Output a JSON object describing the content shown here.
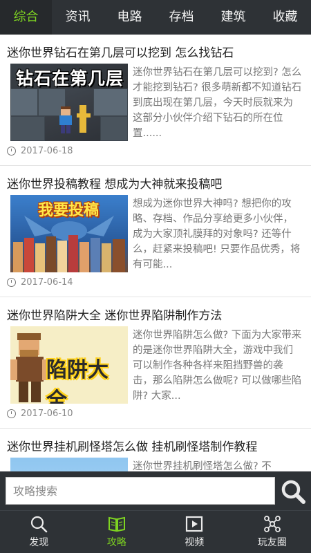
{
  "tabs": [
    {
      "label": "综合",
      "active": true
    },
    {
      "label": "资讯",
      "active": false
    },
    {
      "label": "电路",
      "active": false
    },
    {
      "label": "存档",
      "active": false
    },
    {
      "label": "建筑",
      "active": false
    },
    {
      "label": "收藏",
      "active": false
    }
  ],
  "articles": [
    {
      "title": "迷你世界钻石在第几层可以挖到 怎么找钻石",
      "thumb_text": "钻石在第几层",
      "summary": "迷你世界钻石在第几层可以挖到? 怎么才能挖到钻石? 很多萌新都不知道钻石到底出现在第几层，今天时辰就来为这部分小伙伴介绍下钻石的所在位置......",
      "date": "2017-06-18"
    },
    {
      "title": "迷你世界投稿教程 想成为大神就来投稿吧",
      "thumb_text": "我要投稿",
      "summary": "想成为迷你世界大神吗? 想把你的攻略、存档、作品分享给更多小伙伴，成为大家顶礼膜拜的对象吗? 还等什么，赶紧来投稿吧! 只要作品优秀，将有可能...",
      "date": "2017-06-14"
    },
    {
      "title": "迷你世界陷阱大全 迷你世界陷阱制作方法",
      "thumb_text": "陷阱大全",
      "summary": "迷你世界陷阱怎么做? 下面为大家带来的是迷你世界陷阱大全，游戏中我们可以制作各种各样来阻挡野兽的袭击，那么陷阱怎么做呢? 可以做哪些陷阱? 大家...",
      "date": "2017-06-10"
    },
    {
      "title": "迷你世界挂机刷怪塔怎么做 挂机刷怪塔制作教程",
      "thumb_text": "",
      "summary": "迷你世界挂机刷怪塔怎么做? 不",
      "date": ""
    }
  ],
  "search": {
    "placeholder": "攻略搜索",
    "icon": "search-icon"
  },
  "bottom_nav": [
    {
      "label": "发现",
      "icon": "magnifier-icon",
      "active": false
    },
    {
      "label": "攻略",
      "icon": "book-icon",
      "active": true
    },
    {
      "label": "视频",
      "icon": "video-play-icon",
      "active": false
    },
    {
      "label": "玩友圈",
      "icon": "network-icon",
      "active": false
    }
  ],
  "colors": {
    "bar_background": "#2e3236",
    "accent_green": "#7ed321",
    "summary_text": "#777777"
  }
}
